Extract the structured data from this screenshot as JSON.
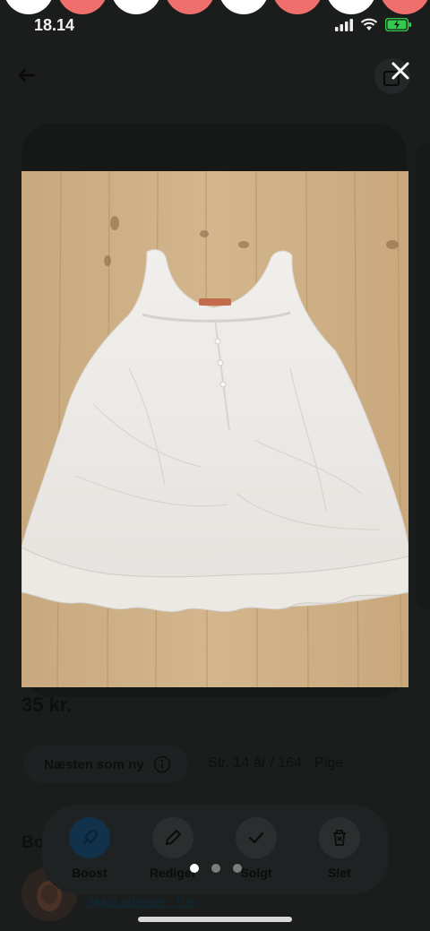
{
  "status_bar": {
    "time": "18.14"
  },
  "listing": {
    "price": "35 kr.",
    "condition": "Næsten som ny",
    "size": "Str. 14 år / 164 · Pige",
    "section_heading": "Bo",
    "address_link": "Skjult adresse · 0 m"
  },
  "actions": {
    "boost": "Boost",
    "edit": "Rediger",
    "sold": "Solgt",
    "delete": "Slet"
  },
  "pager": {
    "pages": 3,
    "current": 1
  },
  "colors": {
    "accent_pink": "#ef6f6c",
    "boost_blue": "#12314a",
    "background": "#1b1d1d"
  },
  "icons": [
    "back-arrow-icon",
    "share-icon",
    "close-icon",
    "info-icon",
    "boost-icon",
    "pencil-icon",
    "check-icon",
    "trash-icon",
    "signal-icon",
    "wifi-icon",
    "battery-icon"
  ]
}
